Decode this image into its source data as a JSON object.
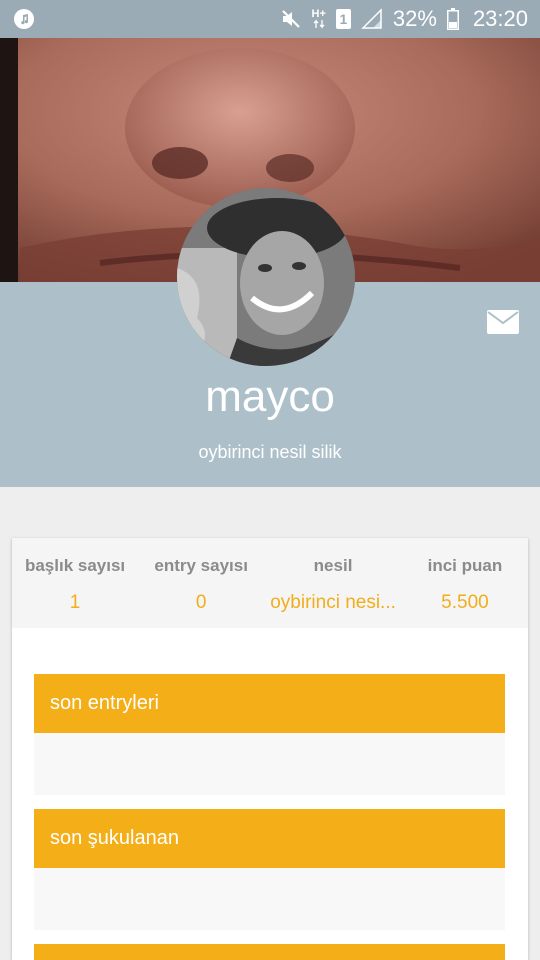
{
  "status_bar": {
    "network_type": "H+",
    "sim_slot": "1",
    "battery": "32%",
    "time": "23:20"
  },
  "profile": {
    "username": "mayco",
    "generation_tag": "oybirinci nesil silik"
  },
  "stats": [
    {
      "label": "başlık sayısı",
      "value": "1"
    },
    {
      "label": "entry sayısı",
      "value": "0"
    },
    {
      "label": "nesil",
      "value": "oybirinci nesi..."
    },
    {
      "label": "inci puan",
      "value": "5.500"
    }
  ],
  "sections": [
    {
      "title": "son entryleri"
    },
    {
      "title": "son şukulanan"
    },
    {
      "title": ""
    }
  ],
  "colors": {
    "accent": "#f3ae18",
    "status_bar": "#9aabb5",
    "profile_band": "#adbfc8"
  }
}
